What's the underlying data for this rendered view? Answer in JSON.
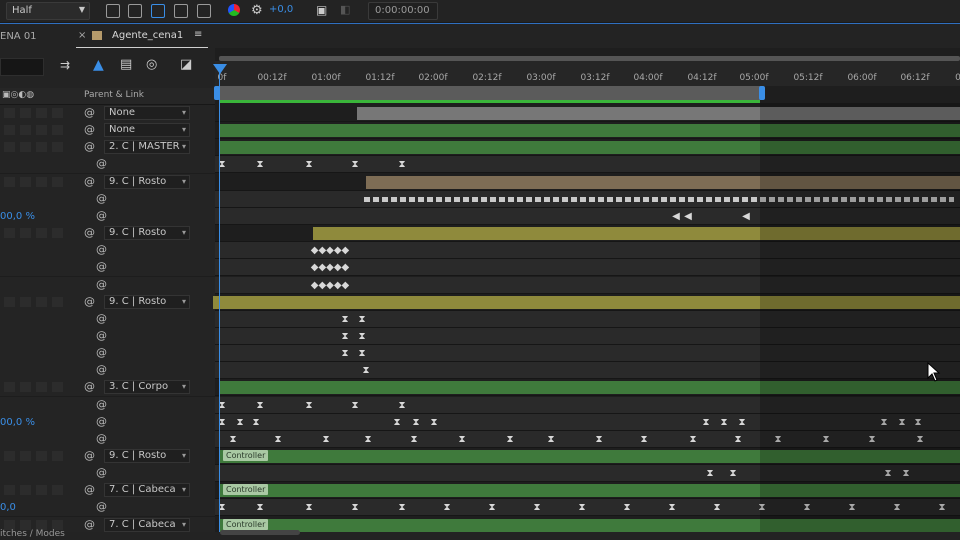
{
  "toolbar": {
    "resolution": "Half",
    "exposure": "+0,0",
    "timecode": "0:00:00:00"
  },
  "tabs": {
    "prev_tab": "ENA 01",
    "active_tab": "Agente_cena1",
    "menu_icon": "hamburger-icon"
  },
  "columns": {
    "parent_link": "Parent & Link"
  },
  "ruler": {
    "labels": [
      "0f",
      "00:12f",
      "01:00f",
      "01:12f",
      "02:00f",
      "02:12f",
      "03:00f",
      "03:12f",
      "04:00f",
      "04:12f",
      "05:00f",
      "05:12f",
      "06:00f",
      "06:12f",
      "0"
    ]
  },
  "layers": [
    {
      "parent": "None",
      "bar": "gray"
    },
    {
      "parent": "None",
      "bar": "green"
    },
    {
      "parent": "2. C | MASTER",
      "bar": "green"
    },
    {
      "value": "",
      "bar": "none"
    },
    {
      "parent": "9. C | Rosto",
      "bar": "tan"
    },
    {
      "value": "",
      "bar": "none"
    },
    {
      "value": "00,0 %",
      "bar": "none"
    },
    {
      "parent": "9. C | Rosto",
      "bar": "olive"
    },
    {
      "value": "",
      "bar": "none"
    },
    {
      "value": "",
      "bar": "none"
    },
    {
      "value": "",
      "bar": "none"
    },
    {
      "parent": "9. C | Rosto",
      "bar": "olive"
    },
    {
      "value": "",
      "bar": "none"
    },
    {
      "value": "",
      "bar": "none"
    },
    {
      "value": "",
      "bar": "none"
    },
    {
      "value": "",
      "bar": "none"
    },
    {
      "parent": "3. C | Corpo",
      "bar": "green"
    },
    {
      "value": "",
      "bar": "none"
    },
    {
      "value": "00,0 %",
      "bar": "none"
    },
    {
      "value": "",
      "bar": "none"
    },
    {
      "parent": "9. C | Rosto",
      "bar": "green",
      "label": "Controller"
    },
    {
      "value": "",
      "bar": "none"
    },
    {
      "parent": "7. C | Cabeca",
      "bar": "green",
      "label": "Controller"
    },
    {
      "value": "0,0",
      "bar": "none"
    },
    {
      "parent": "7. C | Cabeca",
      "bar": "green",
      "label": "Controller"
    }
  ],
  "bottom": {
    "label": "itches / Modes"
  },
  "colors": {
    "accent": "#3a8ee6",
    "green_bar": "#3f7a3c",
    "olive_bar": "#8f8a3c",
    "tan_bar": "#7e6d55",
    "gray_bar": "#6b6b6b"
  }
}
